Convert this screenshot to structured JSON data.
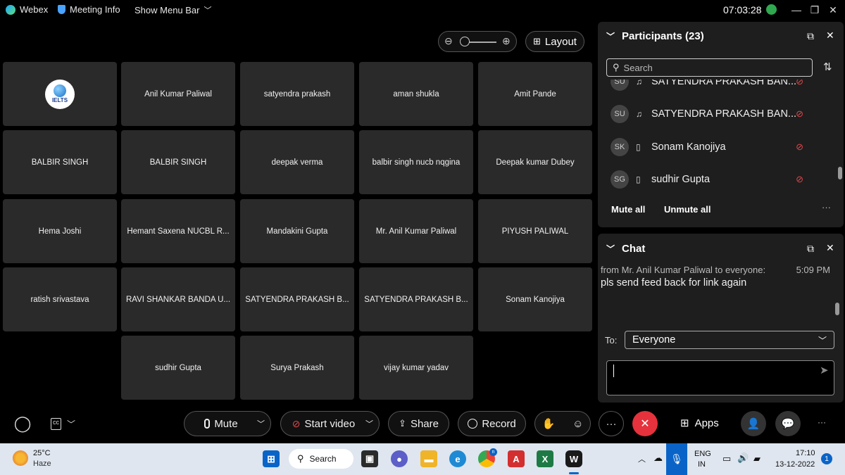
{
  "titlebar": {
    "app_name": "Webex",
    "meeting_info": "Meeting Info",
    "show_menu_bar": "Show Menu Bar",
    "clock": "07:03:28"
  },
  "stage": {
    "layout_label": "Layout",
    "tiles": [
      {
        "name": "IELTS"
      },
      {
        "name": "Anil Kumar Paliwal"
      },
      {
        "name": "satyendra prakash"
      },
      {
        "name": "aman shukla"
      },
      {
        "name": "Amit Pande"
      },
      {
        "name": "BALBIR SINGH"
      },
      {
        "name": "BALBIR SINGH"
      },
      {
        "name": "deepak verma"
      },
      {
        "name": "balbir singh nucb nqgina"
      },
      {
        "name": "Deepak kumar Dubey"
      },
      {
        "name": "Hema Joshi"
      },
      {
        "name": "Hemant Saxena NUCBL R..."
      },
      {
        "name": "Mandakini Gupta"
      },
      {
        "name": "Mr. Anil Kumar Paliwal"
      },
      {
        "name": "PIYUSH PALIWAL"
      },
      {
        "name": "ratish srivastava"
      },
      {
        "name": "RAVI SHANKAR BANDA U..."
      },
      {
        "name": "SATYENDRA PRAKASH B..."
      },
      {
        "name": "SATYENDRA PRAKASH B..."
      },
      {
        "name": "Sonam Kanojiya"
      },
      {
        "name": "sudhir Gupta"
      },
      {
        "name": "Surya Prakash"
      },
      {
        "name": "vijay kumar yadav"
      }
    ]
  },
  "participants": {
    "title": "Participants (23)",
    "search_placeholder": "Search",
    "list": [
      {
        "initials": "SU",
        "name": "SATYENDRA PRAKASH BAN...",
        "device": "headset"
      },
      {
        "initials": "SU",
        "name": "SATYENDRA PRAKASH BAN...",
        "device": "headset"
      },
      {
        "initials": "SK",
        "name": "Sonam Kanojiya",
        "device": "phone"
      },
      {
        "initials": "SG",
        "name": "sudhir Gupta",
        "device": "phone"
      }
    ],
    "mute_all": "Mute all",
    "unmute_all": "Unmute all"
  },
  "chat": {
    "title": "Chat",
    "message": {
      "sender": "from Mr. Anil Kumar Paliwal to everyone:",
      "time": "5:09 PM",
      "text": "pls send feed back for link again"
    },
    "to_label": "To:",
    "to_value": "Everyone"
  },
  "controls": {
    "mute": "Mute",
    "start_video": "Start video",
    "share": "Share",
    "record": "Record",
    "apps": "Apps"
  },
  "taskbar": {
    "weather_temp": "25°C",
    "weather_desc": "Haze",
    "search": "Search",
    "lang_top": "ENG",
    "lang_bottom": "IN",
    "time": "17:10",
    "date": "13-12-2022",
    "notification_count": "1"
  },
  "colors": {
    "background": "#000000",
    "tile": "#2a2a2a",
    "panel": "#1e1e1e",
    "leave_red": "#e5323c",
    "mute_red": "#e0484c",
    "taskbar": "#dfe6ef"
  }
}
